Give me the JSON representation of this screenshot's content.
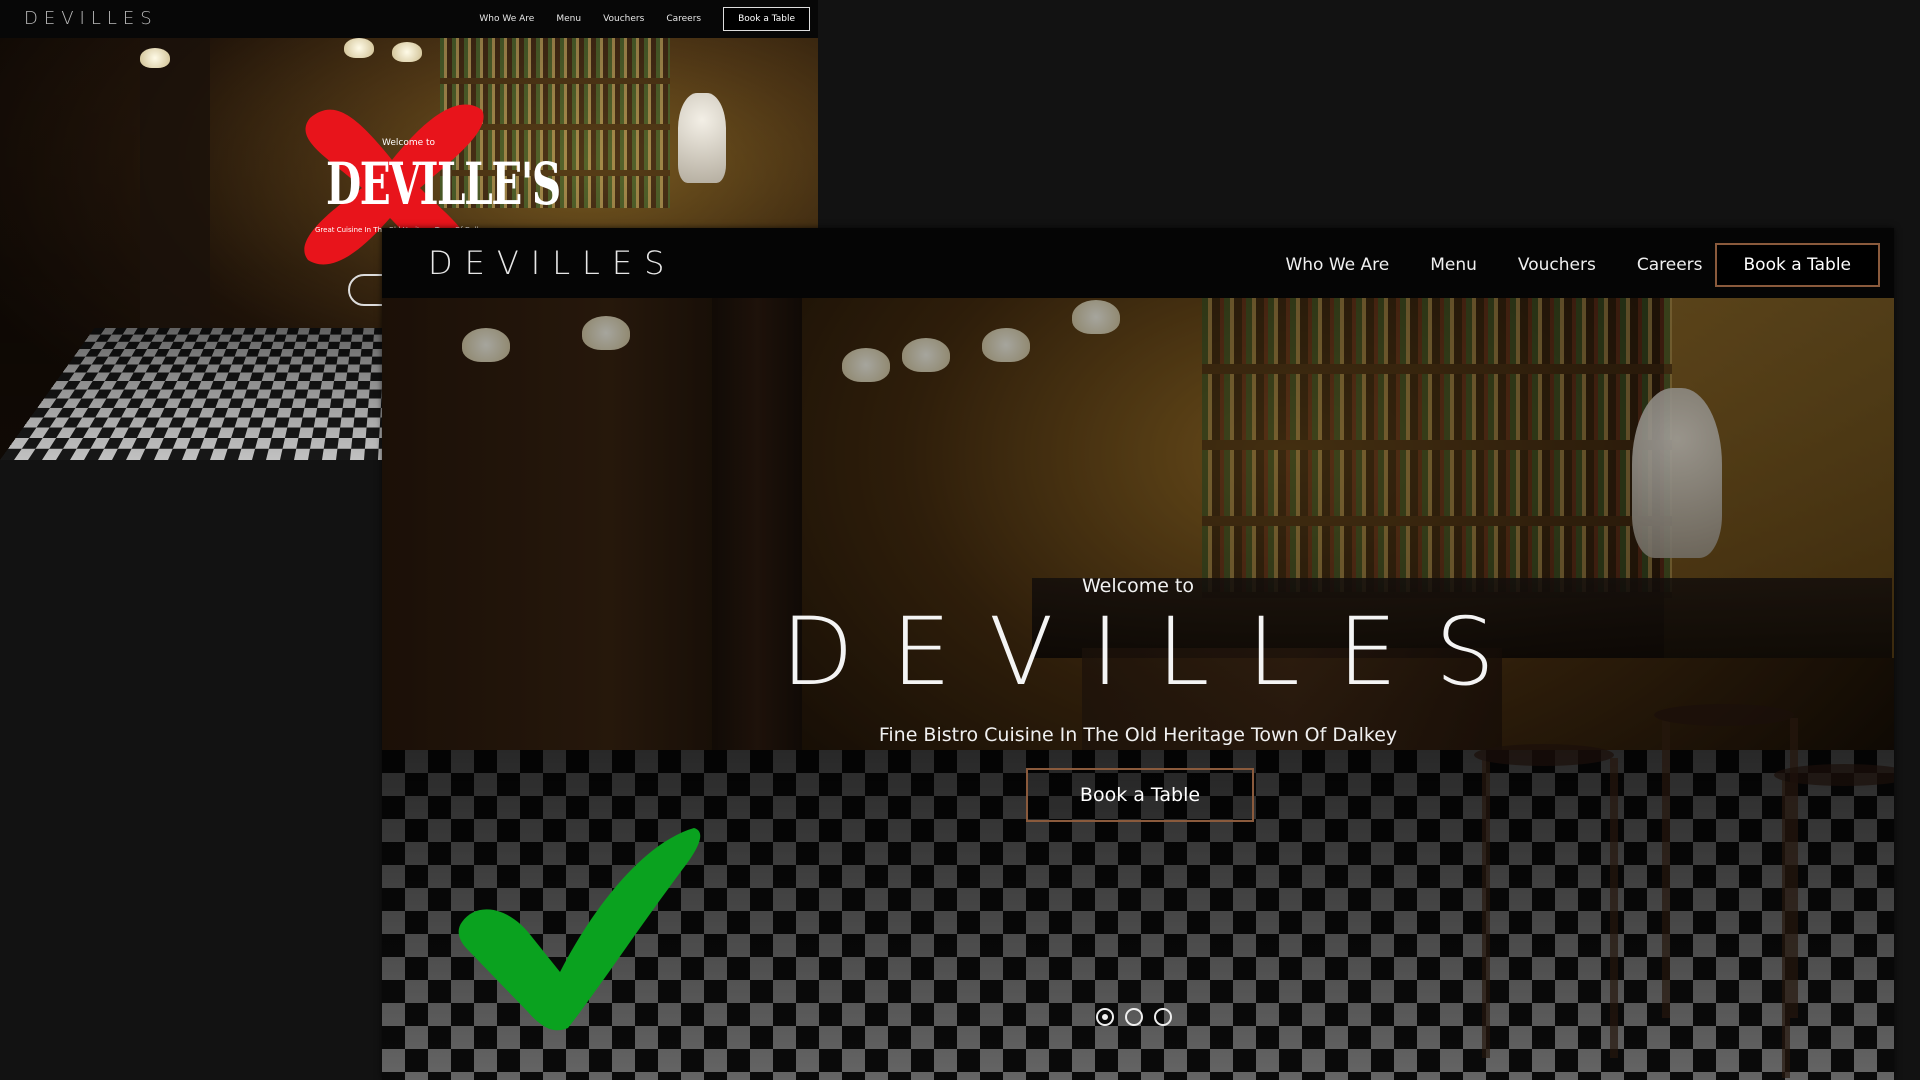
{
  "old_site": {
    "logo": "DEVILLES",
    "nav": [
      "Who We Are",
      "Menu",
      "Vouchers",
      "Careers"
    ],
    "book_label": "Book a Table",
    "hero": {
      "welcome": "Welcome to",
      "title": "DEVILLE'S",
      "subtitle": "Great Cuisine In The Old Heritage Town Of Dalkey"
    },
    "verdict_icon": "red-cross-icon"
  },
  "new_site": {
    "logo": "DEVILLES",
    "nav": [
      "Who We Are",
      "Menu",
      "Vouchers",
      "Careers"
    ],
    "book_label": "Book a Table",
    "hero": {
      "welcome": "Welcome to",
      "title": "DEVILLES",
      "tagline": "Fine Bistro Cuisine In The Old Heritage Town Of Dalkey",
      "cta_label": "Book a Table"
    },
    "carousel": {
      "slides": 3,
      "active": 1
    },
    "verdict_icon": "green-check-icon"
  },
  "colors": {
    "background": "#121212",
    "accent_border": "#8a5a3c",
    "x_mark": "#e8141b",
    "check_mark": "#0aa21f"
  }
}
